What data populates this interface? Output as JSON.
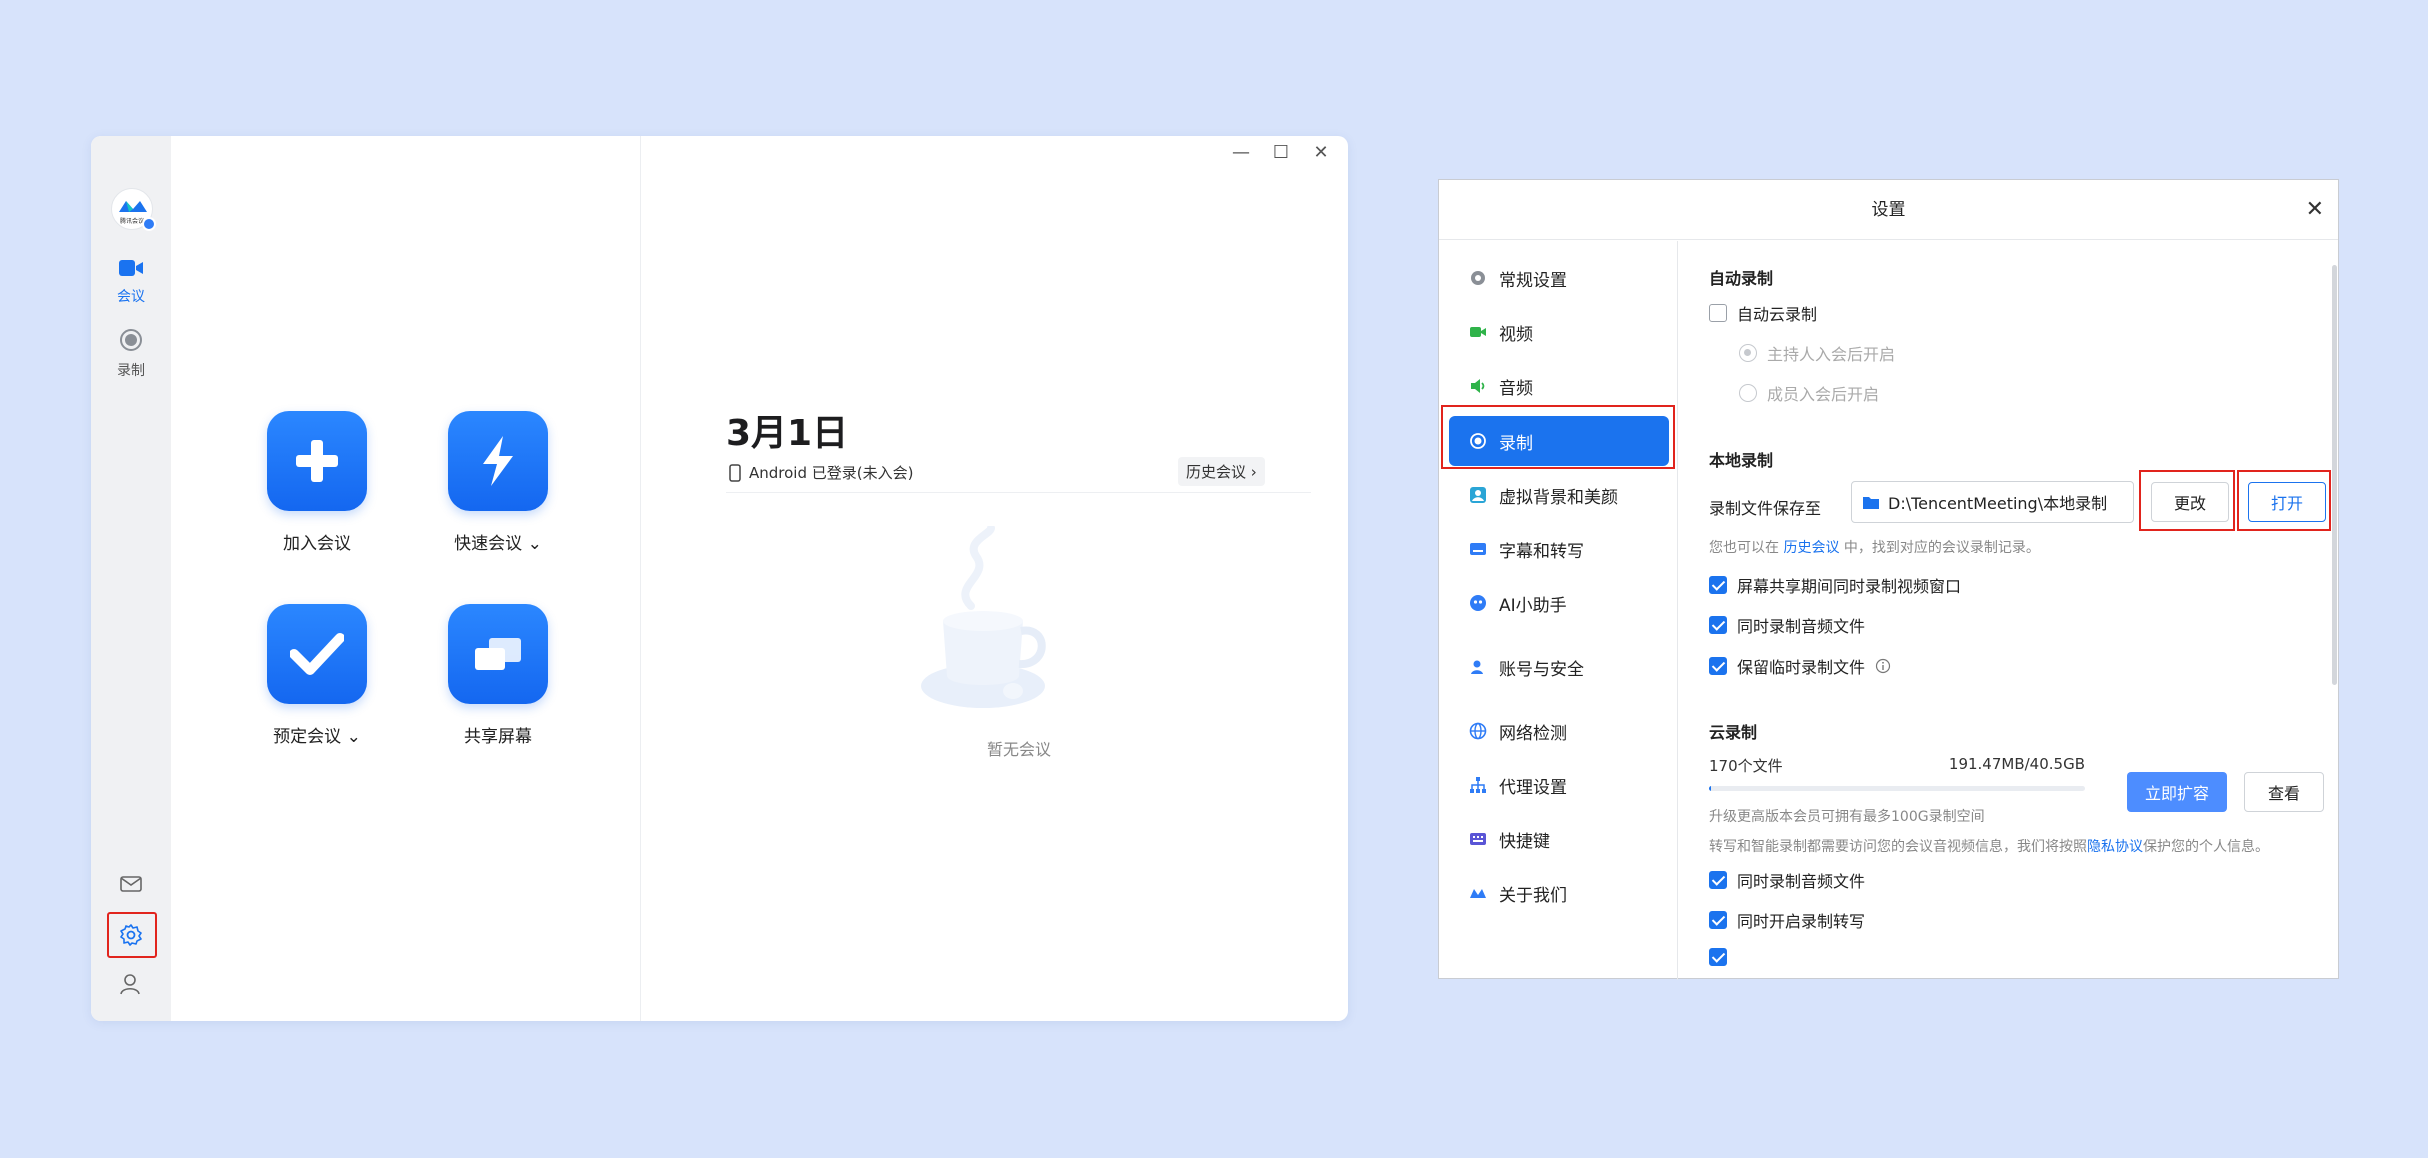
{
  "main_app": {
    "rail": {
      "logo_small": "腾讯会议",
      "meeting_label": "会议",
      "record_label": "录制"
    },
    "window_controls": {
      "minimize": "—",
      "maximize": "☐",
      "close": "✕"
    },
    "actions": {
      "join": "加入会议",
      "quick": "快速会议 ⌄",
      "schedule": "预定会议 ⌄",
      "share": "共享屏幕"
    },
    "date_title": "3月1日",
    "device_status": "Android 已登录(未入会)",
    "history_link": "历史会议 ›",
    "empty_text": "暂无会议"
  },
  "settings": {
    "title": "设置",
    "close": "✕",
    "nav": [
      {
        "label": "常规设置",
        "icon": "gear-icon",
        "color": "#8a8f96"
      },
      {
        "label": "视频",
        "icon": "camera-icon",
        "color": "#2fb34a"
      },
      {
        "label": "音频",
        "icon": "speaker-icon",
        "color": "#2fb34a"
      },
      {
        "label": "录制",
        "icon": "record-icon",
        "color": "#ffffff"
      },
      {
        "label": "虚拟背景和美颜",
        "icon": "portrait-icon",
        "color": "#2aa5d6"
      },
      {
        "label": "字幕和转写",
        "icon": "subtitle-icon",
        "color": "#2f7cf6"
      },
      {
        "label": "AI小助手",
        "icon": "ai-assistant-icon",
        "color": "#2f7cf6"
      },
      {
        "label": "账号与安全",
        "icon": "account-security-icon",
        "color": "#2f7cf6"
      },
      {
        "label": "网络检测",
        "icon": "globe-icon",
        "color": "#2f7cf6"
      },
      {
        "label": "代理设置",
        "icon": "proxy-icon",
        "color": "#2f7cf6"
      },
      {
        "label": "快捷键",
        "icon": "keyboard-icon",
        "color": "#5a55d6"
      },
      {
        "label": "关于我们",
        "icon": "about-logo-icon",
        "color": "#2f7cf6"
      }
    ],
    "auto_record": {
      "title": "自动录制",
      "cloud_auto": "自动云录制",
      "host_join": "主持人入会后开启",
      "member_join": "成员入会后开启"
    },
    "local_record": {
      "title": "本地录制",
      "path_label": "录制文件保存至",
      "path_value": "D:\\TencentMeeting\\本地录制",
      "change_btn": "更改",
      "open_btn": "打开",
      "hint_prefix": "您也可以在",
      "hint_link": "历史会议",
      "hint_suffix": "中，找到对应的会议录制记录。",
      "opt_screen_window": "屏幕共享期间同时录制视频窗口",
      "opt_audio": "同时录制音频文件",
      "opt_temp": "保留临时录制文件"
    },
    "cloud_record": {
      "title": "云录制",
      "file_count": "170个文件",
      "usage": "191.47MB/40.5GB",
      "usage_fraction": 0.005,
      "expand_btn": "立即扩容",
      "view_btn": "查看",
      "upgrade_hint": "升级更高版本会员可拥有最多100G录制空间",
      "privacy_prefix": "转写和智能录制都需要访问您的会议音视频信息，我们将按照",
      "privacy_link": "隐私协议",
      "privacy_suffix": "保护您的个人信息。",
      "opt_audio": "同时录制音频文件",
      "opt_transcribe": "同时开启录制转写"
    }
  },
  "colors": {
    "accent": "#1b73ee",
    "highlight": "#e1241d",
    "background": "#d7e3fb"
  }
}
